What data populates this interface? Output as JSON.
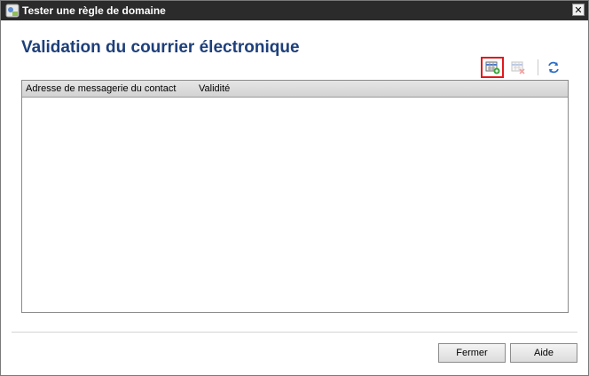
{
  "window": {
    "title": "Tester une règle de domaine",
    "close_symbol": "✕"
  },
  "page": {
    "title": "Validation du courrier électronique"
  },
  "toolbar": {
    "buttons": [
      {
        "icon": "new-item-icon",
        "highlighted": true
      },
      {
        "icon": "delete-icon",
        "enabled": false
      },
      {
        "icon": "refresh-icon"
      }
    ]
  },
  "grid": {
    "columns": [
      "Adresse de messagerie du contact",
      "Validité"
    ],
    "rows": []
  },
  "footer": {
    "close_label": "Fermer",
    "help_label": "Aide"
  },
  "colors": {
    "title_blue": "#1e3f7a",
    "highlight_red": "#e0191e"
  }
}
